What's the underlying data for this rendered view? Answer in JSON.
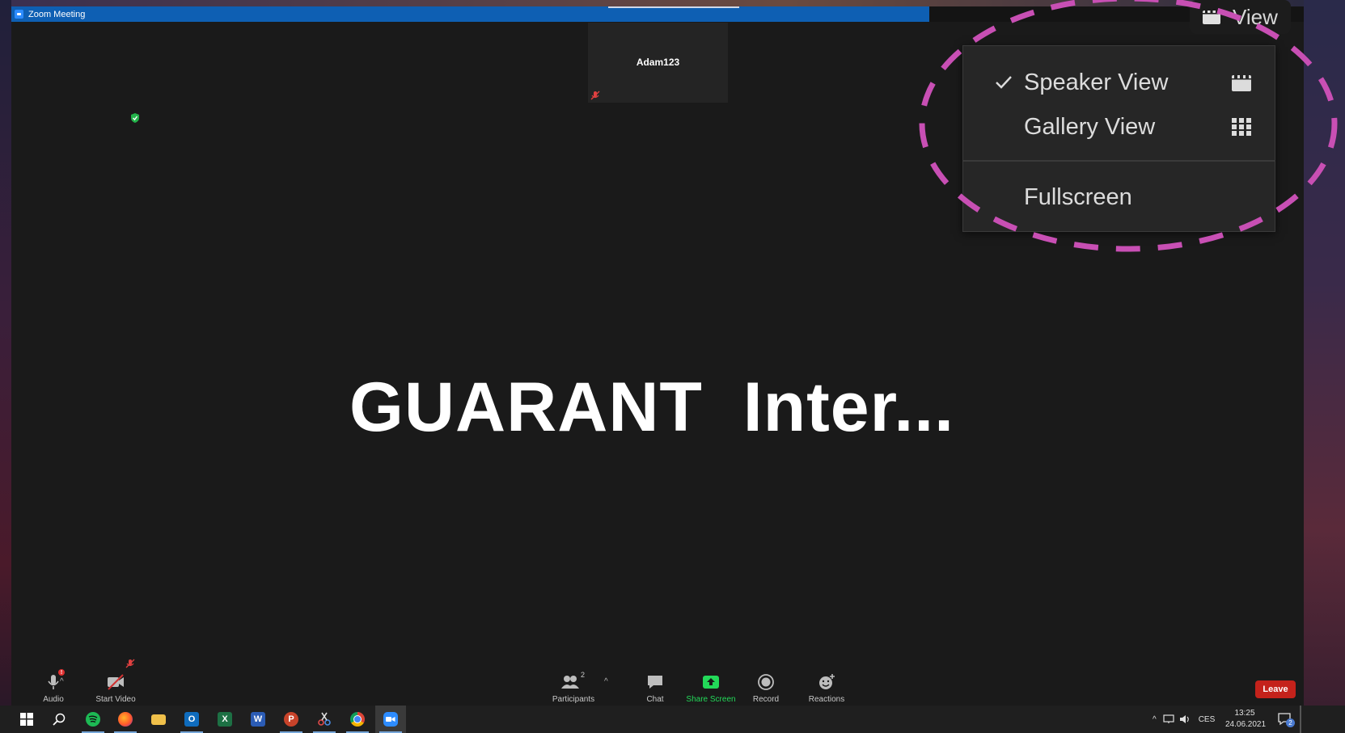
{
  "window": {
    "title": "Zoom Meeting"
  },
  "participant_tile": {
    "name": "Adam123"
  },
  "speaker": {
    "display_name": "GUARANT  Inter..."
  },
  "view_button": {
    "label": "View"
  },
  "view_menu": {
    "items": [
      {
        "label": "Speaker View",
        "checked": true,
        "icon": "speaker-view-icon"
      },
      {
        "label": "Gallery View",
        "checked": false,
        "icon": "gallery-view-icon"
      },
      {
        "label": "Fullscreen",
        "checked": false
      }
    ]
  },
  "toolbar": {
    "audio_label": "Audio",
    "video_label": "Start Video",
    "participants_label": "Participants",
    "participants_count": "2",
    "chat_label": "Chat",
    "share_label": "Share Screen",
    "record_label": "Record",
    "reactions_label": "Reactions",
    "leave_label": "Leave"
  },
  "taskbar": {
    "apps": [
      "windows-start",
      "search",
      "spotify",
      "firefox",
      "file-explorer",
      "outlook",
      "excel",
      "word",
      "powerpoint",
      "snipping-tool",
      "chrome",
      "zoom"
    ],
    "language": "CES",
    "time": "13:25",
    "date": "24.06.2021",
    "notification_count": "2"
  },
  "colors": {
    "title_bar": "#0e5fb3",
    "meeting_bg": "#1a1a1a",
    "share_green": "#23d959",
    "leave_red": "#c4221b",
    "annotation_magenta": "#c84fb4"
  }
}
